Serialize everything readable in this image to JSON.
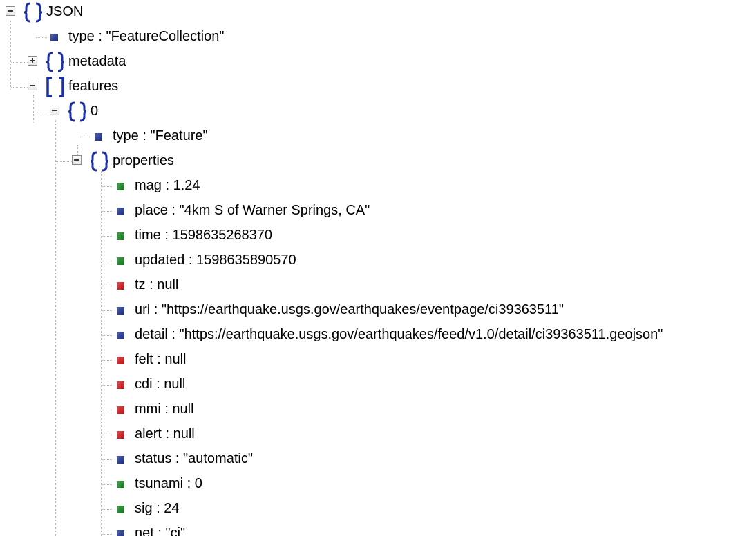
{
  "tree": {
    "root_label": "JSON",
    "root_type": {
      "text": "type : \"FeatureCollection\"",
      "kind": "string"
    },
    "metadata_label": "metadata",
    "features_label": "features",
    "item0_label": "0",
    "item0_type": {
      "text": "type : \"Feature\"",
      "kind": "string"
    },
    "properties_label": "properties",
    "properties": [
      {
        "text": "mag : 1.24",
        "kind": "number"
      },
      {
        "text": "place : \"4km S of Warner Springs, CA\"",
        "kind": "string"
      },
      {
        "text": "time : 1598635268370",
        "kind": "number"
      },
      {
        "text": "updated : 1598635890570",
        "kind": "number"
      },
      {
        "text": "tz : null",
        "kind": "null"
      },
      {
        "text": "url : \"https://earthquake.usgs.gov/earthquakes/eventpage/ci39363511\"",
        "kind": "string"
      },
      {
        "text": "detail : \"https://earthquake.usgs.gov/earthquakes/feed/v1.0/detail/ci39363511.geojson\"",
        "kind": "string"
      },
      {
        "text": "felt : null",
        "kind": "null"
      },
      {
        "text": "cdi : null",
        "kind": "null"
      },
      {
        "text": "mmi : null",
        "kind": "null"
      },
      {
        "text": "alert : null",
        "kind": "null"
      },
      {
        "text": "status : \"automatic\"",
        "kind": "string"
      },
      {
        "text": "tsunami : 0",
        "kind": "number"
      },
      {
        "text": "sig : 24",
        "kind": "number"
      },
      {
        "text": "net : \"ci\"",
        "kind": "string"
      }
    ]
  },
  "colors": {
    "brace_blue": "#1a2fa8",
    "string_leaf": "#1c2d78",
    "number_leaf": "#16701f",
    "null_leaf": "#b01416"
  }
}
